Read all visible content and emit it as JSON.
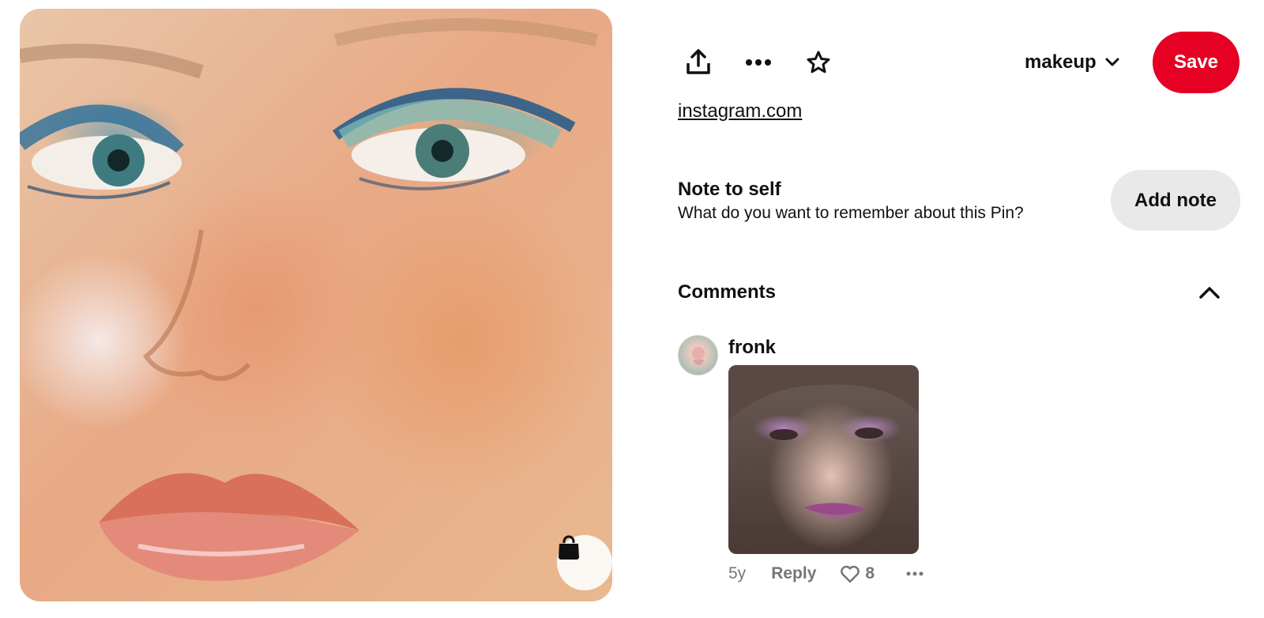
{
  "pin": {
    "image_alt": "Close-up of a face with blue eyeshadow and glossy lips",
    "shop_icon": "shopping-bag-icon"
  },
  "toolbar": {
    "share_icon": "share-icon",
    "more_icon": "more-dots-icon",
    "favorite_icon": "star-icon",
    "board_name": "makeup",
    "board_chevron_icon": "chevron-down-icon",
    "save_label": "Save"
  },
  "source": {
    "link_text": "instagram.com"
  },
  "note": {
    "title": "Note to self",
    "prompt": "What do you want to remember about this Pin?",
    "button_label": "Add note"
  },
  "comments": {
    "title": "Comments",
    "collapse_icon": "chevron-up-icon",
    "items": [
      {
        "author": "fronk",
        "time": "5y",
        "reply_label": "Reply",
        "likes": "8",
        "like_icon": "heart-icon",
        "more_icon": "more-dots-icon"
      }
    ]
  },
  "colors": {
    "accent": "#e60023",
    "button_gray": "#e9e9e9",
    "meta_text": "#767676"
  }
}
